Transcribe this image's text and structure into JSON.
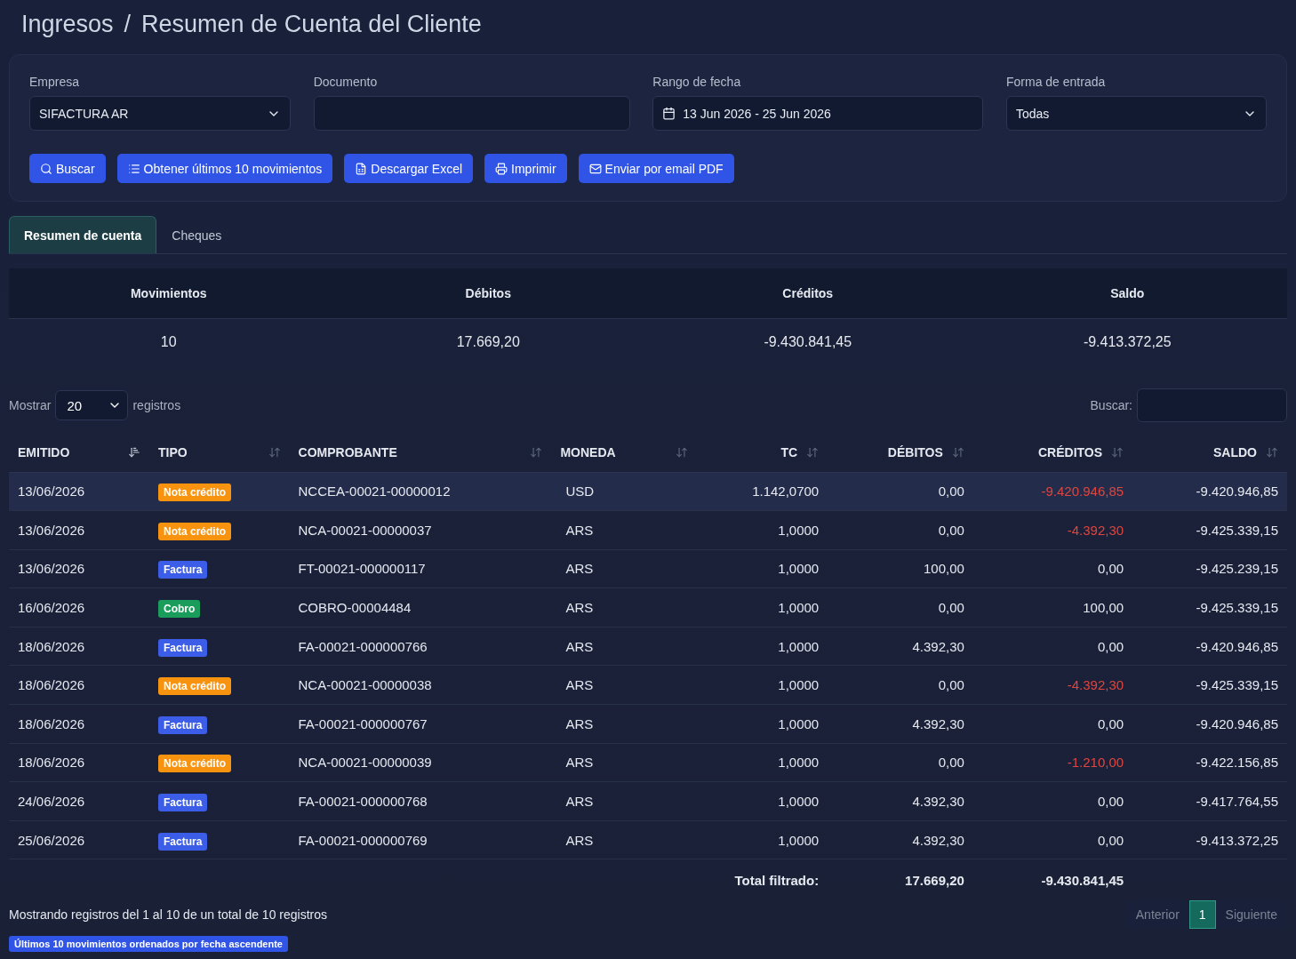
{
  "breadcrumb": [
    "Ingresos",
    "/",
    "Resumen de Cuenta del Cliente"
  ],
  "filters": {
    "empresa": {
      "label": "Empresa",
      "value": "SIFACTURA AR"
    },
    "documento": {
      "label": "Documento"
    },
    "rango": {
      "label": "Rango de fecha",
      "value": "13 Jun 2026 - 25 Jun 2026"
    },
    "forma": {
      "label": "Forma de entrada",
      "value": "Todas"
    }
  },
  "buttons": [
    {
      "kind": "search",
      "label": "Buscar"
    },
    {
      "kind": "list",
      "label": "Obtener últimos 10 movimientos"
    },
    {
      "kind": "excel",
      "label": "Descargar Excel"
    },
    {
      "kind": "print",
      "label": "Imprimir"
    },
    {
      "kind": "email",
      "label": "Enviar por email PDF"
    }
  ],
  "tabs": [
    {
      "label": "Resumen de cuenta",
      "selected": true
    },
    {
      "label": "Cheques",
      "selected": false
    }
  ],
  "summary": {
    "columns": [
      "Movimientos",
      "Débitos",
      "Créditos",
      "Saldo"
    ],
    "values": [
      "10",
      "17.669,20",
      "-9.430.841,45",
      "-9.413.372,25"
    ]
  },
  "length_control": {
    "before": "Mostrar",
    "value": "20",
    "after": "registros"
  },
  "search": {
    "label": "Buscar:"
  },
  "table": {
    "columns": [
      {
        "label": "EMITIDO",
        "sorted": true
      },
      {
        "label": "TIPO",
        "sorted": false
      },
      {
        "label": "COMPROBANTE",
        "sorted": false
      },
      {
        "label": "MONEDA",
        "sorted": false
      },
      {
        "label": "TC",
        "sorted": false
      },
      {
        "label": "DÉBITOS",
        "sorted": false
      },
      {
        "label": "CRÉDITOS",
        "sorted": false
      },
      {
        "label": "SALDO",
        "sorted": false
      }
    ],
    "rows": [
      {
        "selected": true,
        "emitido": "13/06/2026",
        "tipo": {
          "label": "Nota crédito",
          "color": "#f7930f"
        },
        "comprobante": "NCCEA-00021-00000012",
        "moneda": "USD",
        "tc": "1.142,0700",
        "debitos": "0,00",
        "creditos": "-9.420.946,85",
        "credit_negative": true,
        "saldo": "-9.420.946,85"
      },
      {
        "selected": false,
        "emitido": "13/06/2026",
        "tipo": {
          "label": "Nota crédito",
          "color": "#f7930f"
        },
        "comprobante": "NCA-00021-00000037",
        "moneda": "ARS",
        "tc": "1,0000",
        "debitos": "0,00",
        "creditos": "-4.392,30",
        "credit_negative": true,
        "saldo": "-9.425.339,15"
      },
      {
        "selected": false,
        "emitido": "13/06/2026",
        "tipo": {
          "label": "Factura",
          "color": "#3b5de7"
        },
        "comprobante": "FT-00021-000000117",
        "moneda": "ARS",
        "tc": "1,0000",
        "debitos": "100,00",
        "creditos": "0,00",
        "credit_negative": false,
        "saldo": "-9.425.239,15"
      },
      {
        "selected": false,
        "emitido": "16/06/2026",
        "tipo": {
          "label": "Cobro",
          "color": "#1a9c5b"
        },
        "comprobante": "COBRO-00004484",
        "moneda": "ARS",
        "tc": "1,0000",
        "debitos": "0,00",
        "creditos": "100,00",
        "credit_negative": false,
        "saldo": "-9.425.339,15"
      },
      {
        "selected": false,
        "emitido": "18/06/2026",
        "tipo": {
          "label": "Factura",
          "color": "#3b5de7"
        },
        "comprobante": "FA-00021-000000766",
        "moneda": "ARS",
        "tc": "1,0000",
        "debitos": "4.392,30",
        "creditos": "0,00",
        "credit_negative": false,
        "saldo": "-9.420.946,85"
      },
      {
        "selected": false,
        "emitido": "18/06/2026",
        "tipo": {
          "label": "Nota crédito",
          "color": "#f7930f"
        },
        "comprobante": "NCA-00021-00000038",
        "moneda": "ARS",
        "tc": "1,0000",
        "debitos": "0,00",
        "creditos": "-4.392,30",
        "credit_negative": true,
        "saldo": "-9.425.339,15"
      },
      {
        "selected": false,
        "emitido": "18/06/2026",
        "tipo": {
          "label": "Factura",
          "color": "#3b5de7"
        },
        "comprobante": "FA-00021-000000767",
        "moneda": "ARS",
        "tc": "1,0000",
        "debitos": "4.392,30",
        "creditos": "0,00",
        "credit_negative": false,
        "saldo": "-9.420.946,85"
      },
      {
        "selected": false,
        "emitido": "18/06/2026",
        "tipo": {
          "label": "Nota crédito",
          "color": "#f7930f"
        },
        "comprobante": "NCA-00021-00000039",
        "moneda": "ARS",
        "tc": "1,0000",
        "debitos": "0,00",
        "creditos": "-1.210,00",
        "credit_negative": true,
        "saldo": "-9.422.156,85"
      },
      {
        "selected": false,
        "emitido": "24/06/2026",
        "tipo": {
          "label": "Factura",
          "color": "#3b5de7"
        },
        "comprobante": "FA-00021-000000768",
        "moneda": "ARS",
        "tc": "1,0000",
        "debitos": "4.392,30",
        "creditos": "0,00",
        "credit_negative": false,
        "saldo": "-9.417.764,55"
      },
      {
        "selected": false,
        "emitido": "25/06/2026",
        "tipo": {
          "label": "Factura",
          "color": "#3b5de7"
        },
        "comprobante": "FA-00021-000000769",
        "moneda": "ARS",
        "tc": "1,0000",
        "debitos": "4.392,30",
        "creditos": "0,00",
        "credit_negative": false,
        "saldo": "-9.413.372,25"
      }
    ],
    "total": {
      "label": "Total filtrado:",
      "debitos": "17.669,20",
      "creditos": "-9.430.841,45"
    }
  },
  "info": "Mostrando registros del 1 al 10 de un total de 10 registros",
  "pagination": {
    "previous": "Anterior",
    "pages": [
      {
        "label": "1",
        "selected": true
      }
    ],
    "next": "Siguiente"
  },
  "note": "Últimos 10 movimientos ordenados por fecha ascendente"
}
